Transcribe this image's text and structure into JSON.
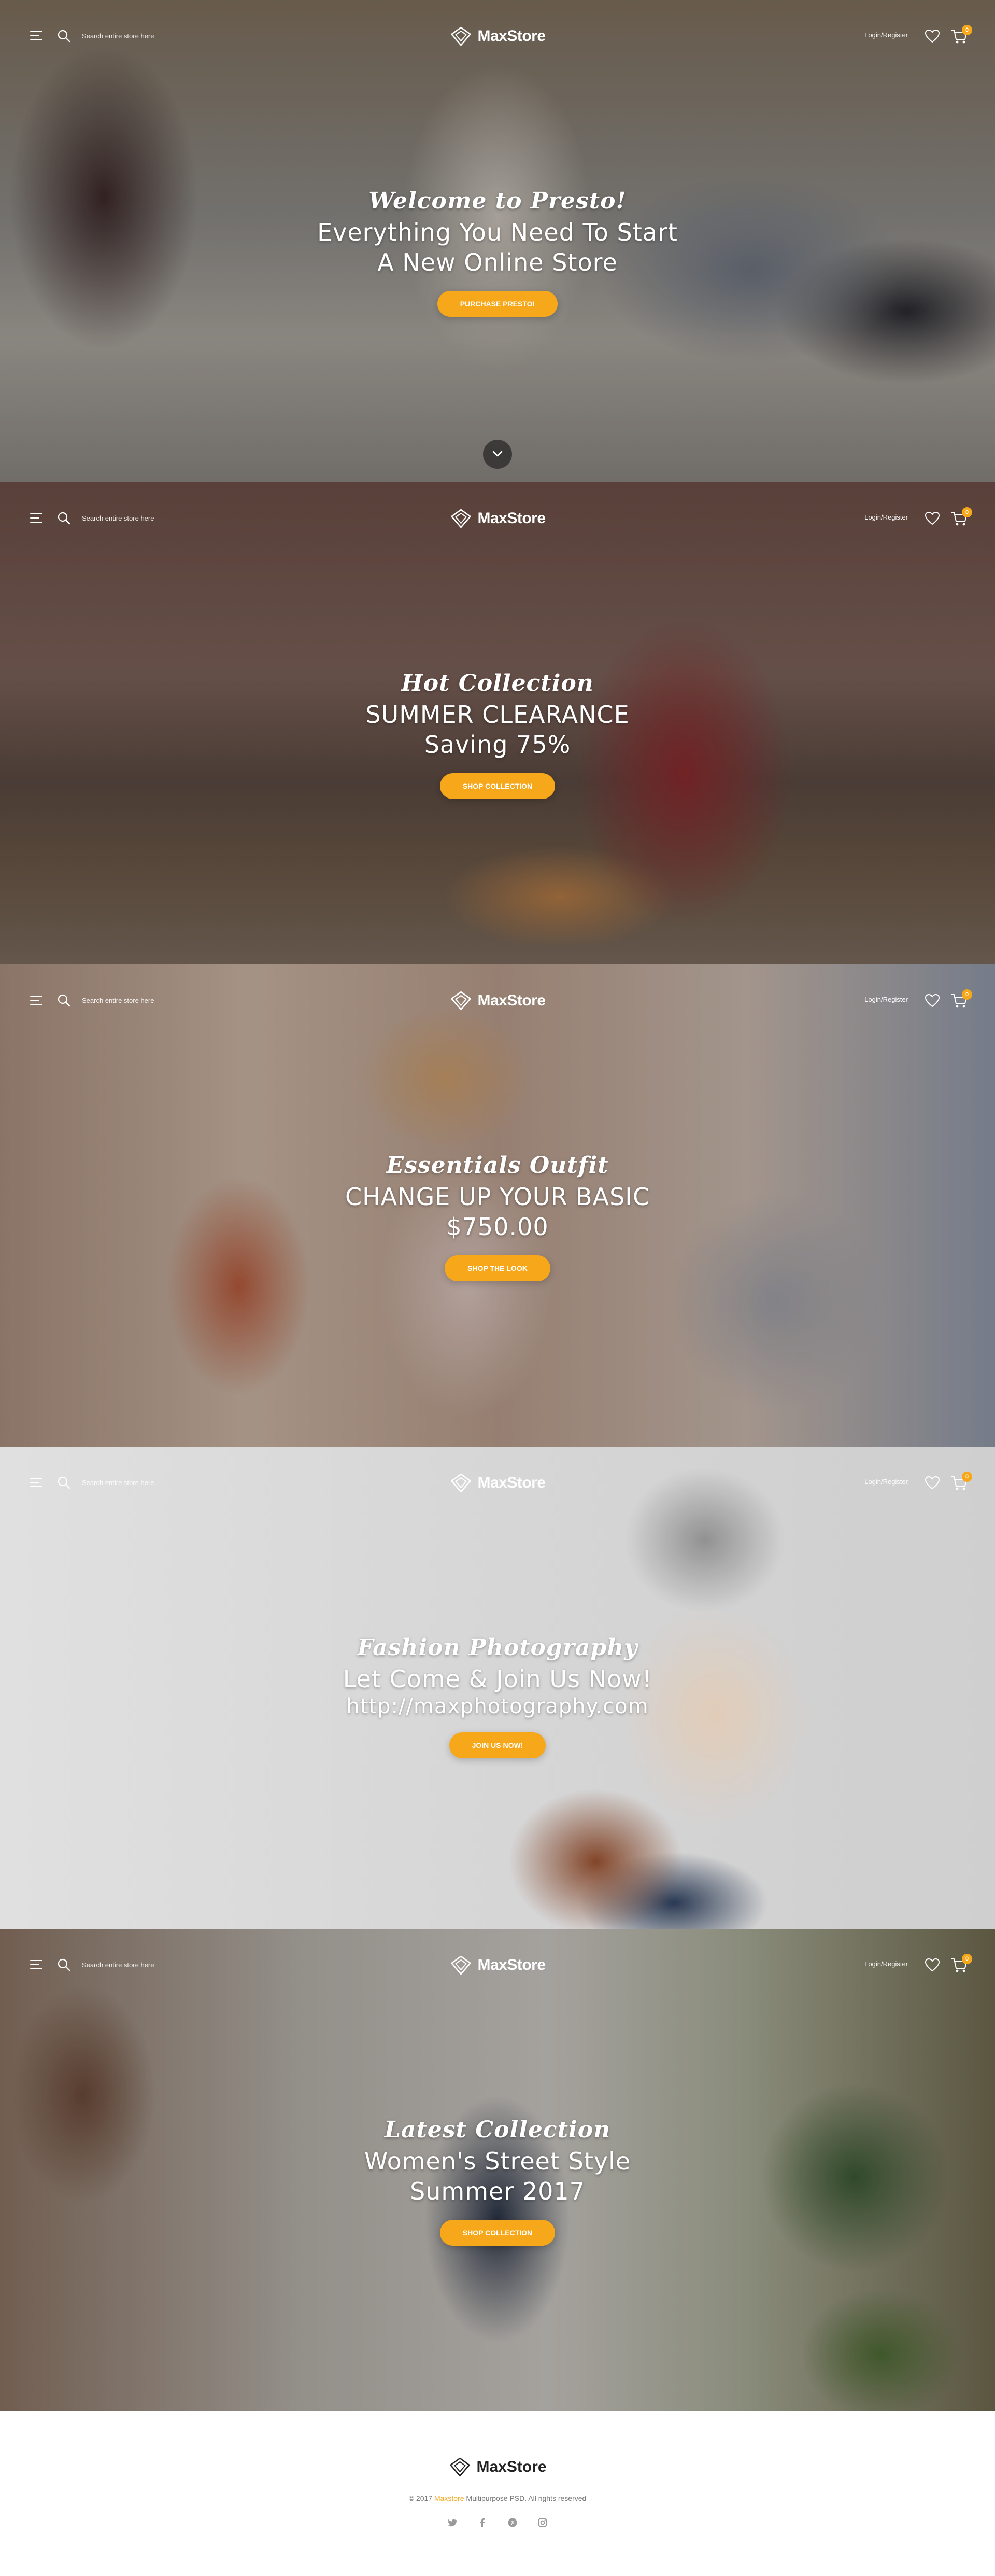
{
  "header": {
    "search_placeholder": "Search entire store here",
    "logo_text": "MaxStore",
    "login_label": "Login/Register",
    "cart_count": "0"
  },
  "slides": [
    {
      "script": "Welcome to Presto!",
      "title_line1": "Everything You Need To Start",
      "title_line2": "A New Online Store",
      "button": "PURCHASE PRESTO!"
    },
    {
      "script": "Hot Collection",
      "title_line1": "SUMMER CLEARANCE",
      "title_line2": "Saving 75%",
      "button": "SHOP COLLECTION"
    },
    {
      "script": "Essentials Outfit",
      "title_line1": "CHANGE UP YOUR BASIC",
      "title_line2": "$750.00",
      "button": "SHOP THE LOOK"
    },
    {
      "script": "Fashion Photography",
      "title_line1": "Let Come & Join Us Now!",
      "title_line2": "http://maxphotography.com",
      "button": "JOIN US NOW!"
    },
    {
      "script": "Latest Collection",
      "title_line1": "Women's Street Style",
      "title_line2": "Summer 2017",
      "button": "SHOP COLLECTION"
    }
  ],
  "footer": {
    "logo_text": "MaxStore",
    "copyright_prefix": "© 2017",
    "copyright_brand": "Maxstore",
    "copyright_suffix": "Multipurpose PSD. All rights reserved",
    "social": [
      "twitter-icon",
      "facebook-icon",
      "pinterest-icon",
      "instagram-icon"
    ]
  },
  "colors": {
    "accent": "#f6a81a",
    "text_light": "#ffffff",
    "footer_text": "#777777"
  }
}
